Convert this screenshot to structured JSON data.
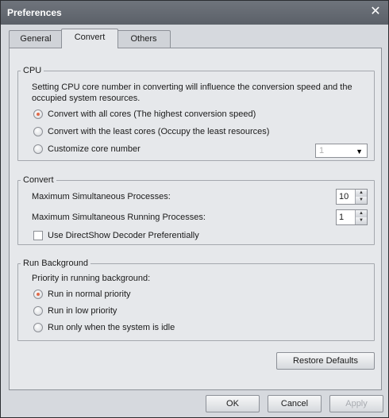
{
  "window": {
    "title": "Preferences",
    "close_glyph": "✕"
  },
  "tabs": [
    {
      "label": "General",
      "active": false
    },
    {
      "label": "Convert",
      "active": true
    },
    {
      "label": "Others",
      "active": false
    }
  ],
  "cpu": {
    "legend": "CPU",
    "description_line1": "Setting CPU core number in converting will influence the conversion speed and the",
    "description_line2": "occupied system resources.",
    "options": [
      {
        "label": "Convert with all cores (The highest conversion speed)",
        "checked": true
      },
      {
        "label": "Convert with the least cores (Occupy the least resources)",
        "checked": false
      },
      {
        "label": "Customize core number",
        "checked": false
      }
    ],
    "core_select_value": "1"
  },
  "convert": {
    "legend": "Convert",
    "max_processes_label": "Maximum Simultaneous Processes:",
    "max_processes_value": "10",
    "max_running_label": "Maximum Simultaneous Running Processes:",
    "max_running_value": "1",
    "directshow_label": "Use DirectShow Decoder Preferentially",
    "directshow_checked": false
  },
  "background": {
    "legend": "Run Background",
    "priority_label": "Priority in running background:",
    "options": [
      {
        "label": "Run in normal priority",
        "checked": true
      },
      {
        "label": "Run in low priority",
        "checked": false
      },
      {
        "label": "Run only when the system is idle",
        "checked": false
      }
    ]
  },
  "buttons": {
    "restore_defaults": "Restore Defaults",
    "ok": "OK",
    "cancel": "Cancel",
    "apply": "Apply"
  },
  "colors": {
    "accent_radio": "#e06a4a",
    "titlebar": "#5b6068"
  }
}
